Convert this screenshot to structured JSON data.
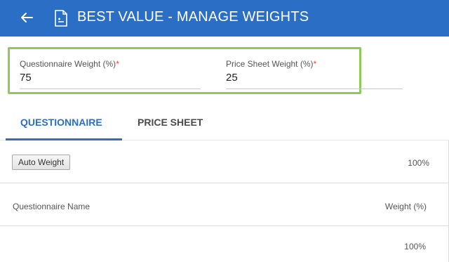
{
  "header": {
    "title": "BEST VALUE - MANAGE WEIGHTS",
    "back_icon": "arrow-left-icon",
    "title_icon": "document-icon",
    "bg_color": "#2a6ec6"
  },
  "weights": {
    "questionnaire": {
      "label": "Questionnaire Weight (%)",
      "required_mark": "*",
      "value": "75"
    },
    "price_sheet": {
      "label": "Price Sheet Weight (%)",
      "required_mark": "*",
      "value": "25"
    },
    "highlight_color": "#8ccb57"
  },
  "tabs": [
    {
      "label": "QUESTIONNAIRE",
      "active": true
    },
    {
      "label": "PRICE SHEET",
      "active": false
    }
  ],
  "table": {
    "auto_weight_label": "Auto Weight",
    "total_top": "100%",
    "columns": {
      "name": "Questionnaire Name",
      "weight": "Weight (%)"
    },
    "total_bottom": "100%"
  }
}
